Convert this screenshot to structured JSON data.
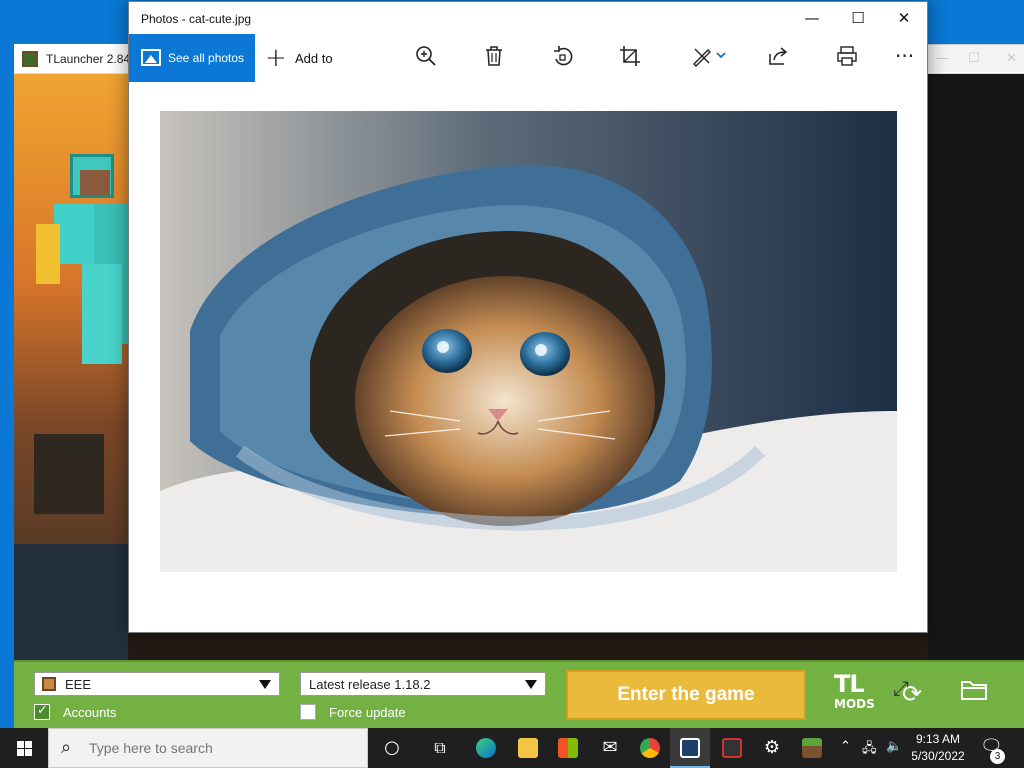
{
  "photos_window": {
    "title": "Photos - cat-cute.jpg",
    "controls": {
      "minimize": "—",
      "maximize": "☐",
      "close": "✕"
    },
    "toolbar": {
      "see_all_photos": "See all photos",
      "add_to": "Add to",
      "icons": [
        "zoom-icon",
        "delete-icon",
        "rotate-icon",
        "crop-icon",
        "edit-icon",
        "share-icon",
        "print-icon",
        "more-icon"
      ],
      "more": "···"
    },
    "image": {
      "subject": "kitten in denim"
    },
    "accent_color": "#0a78d4"
  },
  "tlauncher": {
    "title": "TLauncher 2.841",
    "account": {
      "name": "EEE",
      "checkbox_label": "Accounts",
      "checked": true
    },
    "version": {
      "selected": "Latest release 1.18.2",
      "checkbox_label": "Force update",
      "checked": false
    },
    "enter_button": "Enter the game",
    "mods_logo": {
      "line1": "TL",
      "line2": "MODS"
    },
    "bg_color": "#73b143",
    "button_color": "#eaba3c"
  },
  "taskbar": {
    "search_placeholder": "Type here to search",
    "apps": [
      "cortana-icon",
      "task-view-icon",
      "edge-icon",
      "file-explorer-icon",
      "store-icon",
      "mail-icon",
      "chrome-icon",
      "photos-icon",
      "app-icon",
      "settings-icon",
      "minecraft-icon"
    ],
    "clock": {
      "time": "9:13 AM",
      "date": "5/30/2022"
    },
    "notification_count": "3"
  }
}
